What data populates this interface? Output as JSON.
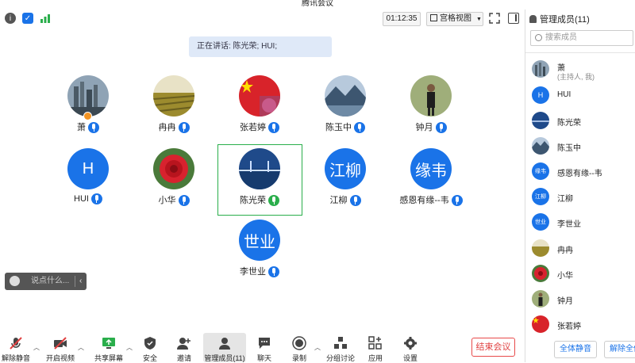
{
  "window": {
    "title": "腾讯会议"
  },
  "topbar": {
    "timer": "01:12:35",
    "view_label": "宫格视图"
  },
  "speaking": {
    "text": "正在讲话: 陈光荣; HUI;"
  },
  "tiles": [
    {
      "name": "萧",
      "avatar": "cityscape",
      "mic": "blue",
      "host": true
    },
    {
      "name": "冉冉",
      "avatar": "field",
      "mic": "blue"
    },
    {
      "name": "张若婷",
      "avatar": "flag",
      "mic": "blue"
    },
    {
      "name": "陈玉中",
      "avatar": "mountain",
      "mic": "blue"
    },
    {
      "name": "钟月",
      "avatar": "person",
      "mic": "blue"
    },
    {
      "name": "HUI",
      "avatar_text": "H",
      "mic": "blue"
    },
    {
      "name": "小华",
      "avatar": "rose",
      "mic": "blue"
    },
    {
      "name": "陈光荣",
      "avatar": "bridge",
      "mic": "green",
      "active": true
    },
    {
      "name": "江柳",
      "avatar_text": "江柳",
      "mic": "blue"
    },
    {
      "name": "感恩有缘--韦",
      "avatar_text": "缘韦",
      "mic": "blue"
    },
    {
      "name": "李世业",
      "avatar_text": "世业",
      "mic": "blue"
    }
  ],
  "chat": {
    "placeholder": "说点什么..."
  },
  "toolbar": {
    "unmute": "解除静音",
    "video": "开启视频",
    "share": "共享屏幕",
    "security": "安全",
    "invite": "邀请",
    "members": "管理成员(11)",
    "chat": "聊天",
    "record": "录制",
    "breakout": "分组讨论",
    "apps": "应用",
    "settings": "设置",
    "end": "结束会议"
  },
  "panel": {
    "title": "管理成员(11)",
    "search_placeholder": "搜索成员",
    "members": [
      {
        "name": "萧",
        "sub": "(主持人, 我)",
        "avatar": "cityscape"
      },
      {
        "name": "HUI",
        "avatar_text": "H"
      },
      {
        "name": "陈光荣",
        "avatar": "bridge"
      },
      {
        "name": "陈玉中",
        "avatar": "mountain"
      },
      {
        "name": "感恩有缘--韦",
        "avatar_text": "缘韦"
      },
      {
        "name": "江柳",
        "avatar_text": "江柳"
      },
      {
        "name": "李世业",
        "avatar_text": "世业"
      },
      {
        "name": "冉冉",
        "avatar": "field"
      },
      {
        "name": "小华",
        "avatar": "rose"
      },
      {
        "name": "钟月",
        "avatar": "person"
      },
      {
        "name": "张若婷",
        "avatar": "flag"
      }
    ],
    "mute_all": "全体静音",
    "unmute_all": "解除全体静音"
  },
  "colors": {
    "accent": "#1a73e8",
    "active_speaker": "#2aae4b",
    "end": "#e04040"
  }
}
